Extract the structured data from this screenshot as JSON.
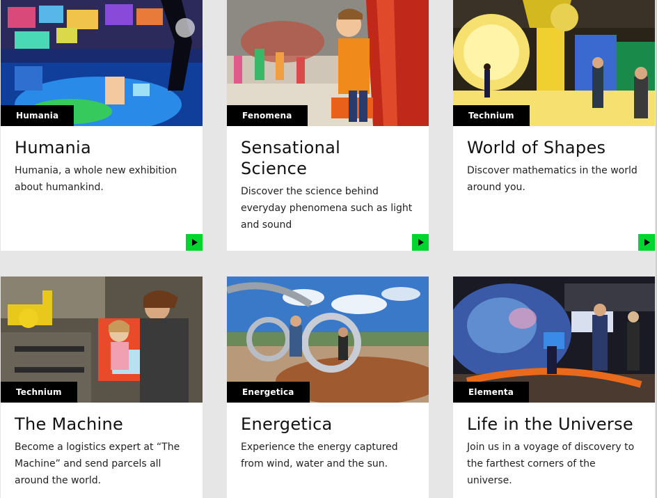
{
  "cards": [
    {
      "tag": "Humania",
      "title": "Humania",
      "text": "Humania, a whole new exhibition about humankind.",
      "arrow": true
    },
    {
      "tag": "Fenomena",
      "title": "Sensational Science",
      "text": "Discover the science behind everyday phenomena such as light and sound",
      "arrow": true
    },
    {
      "tag": "Technium",
      "title": "World of Shapes",
      "text": "Discover mathematics in the world around you.",
      "arrow": true
    },
    {
      "tag": "Technium",
      "title": "The Machine",
      "text": "Become a logistics expert at “The Machine” and send parcels all around the world.",
      "arrow": false
    },
    {
      "tag": "Energetica",
      "title": "Energetica",
      "text": "Experience the energy captured from wind, water and the sun.",
      "arrow": false
    },
    {
      "tag": "Elementa",
      "title": "Life in the Universe",
      "text": "Join us in a voyage of discovery to the farthest corners of the universe.",
      "arrow": false
    }
  ],
  "colors": {
    "background": "#e6e6e6",
    "card": "#ffffff",
    "tag_bg": "#000000",
    "arrow_button": "#00d62e"
  },
  "icons": {
    "arrow": "play-arrow-icon"
  }
}
